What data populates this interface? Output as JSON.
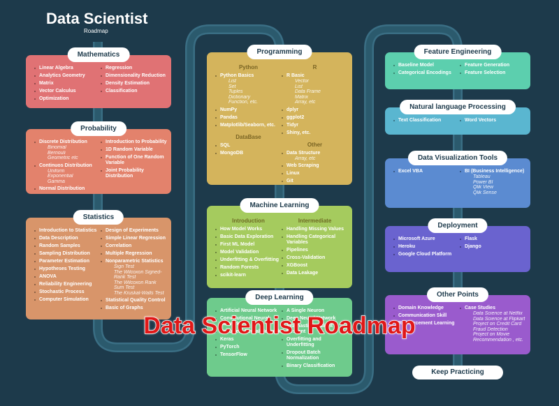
{
  "header": {
    "title": "Data Scientist",
    "subtitle": "Roadmap"
  },
  "panels": [
    {
      "title": "Mathematics",
      "color": "#e07274",
      "cols": [
        [
          {
            "items": [
              {
                "t": "Linear Algebra"
              },
              {
                "t": "Analytics Geometry"
              },
              {
                "t": "Matrix"
              },
              {
                "t": "Vector Calculus"
              },
              {
                "t": "Optimization"
              }
            ]
          }
        ],
        [
          {
            "items": [
              {
                "t": "Regression"
              },
              {
                "t": "Dimensionality Reduction"
              },
              {
                "t": "Density Estimation"
              },
              {
                "t": "Classification"
              }
            ]
          }
        ]
      ]
    },
    {
      "title": "Probability",
      "color": "#e3826c",
      "cols": [
        [
          {
            "items": [
              {
                "t": "Discrete Distribution",
                "sub": [
                  "Binomial",
                  "Bernouli",
                  "Geometric etc"
                ]
              },
              {
                "t": "Continuos Distribution",
                "sub": [
                  "Uniform",
                  "Exponential",
                  "Gamma"
                ]
              },
              {
                "t": "Normal Distribution"
              }
            ]
          }
        ],
        [
          {
            "items": [
              {
                "t": "Introduction to Probability"
              },
              {
                "t": "1D Random Variable"
              },
              {
                "t": "Function of One Random Variable"
              },
              {
                "t": "Joint Probability Distribution"
              }
            ]
          }
        ]
      ]
    },
    {
      "title": "Statistics",
      "color": "#d8956a",
      "cols": [
        [
          {
            "items": [
              {
                "t": "Introduction to Statistics"
              },
              {
                "t": "Data Description"
              },
              {
                "t": "Random Samples"
              },
              {
                "t": "Sampling Distribution"
              },
              {
                "t": "Parameter Estimation"
              },
              {
                "t": "Hypotheses Testing"
              },
              {
                "t": "ANOVA"
              },
              {
                "t": "Reliability Engineering"
              },
              {
                "t": "Stochastic Process"
              },
              {
                "t": "Computer Simulation"
              }
            ]
          }
        ],
        [
          {
            "items": [
              {
                "t": "Design of Experiments"
              },
              {
                "t": "Simple Linear Regression"
              },
              {
                "t": "Correlation"
              },
              {
                "t": "Multiple Regression"
              },
              {
                "t": "Nonparametric Statistics",
                "sub": [
                  "Sign Test",
                  "The Wilcoxon Signed-Rank Test",
                  "The Wilcoxon Rank Sum Test",
                  "The Kruskal-Walls Test"
                ]
              },
              {
                "t": "Statistical Quality Control"
              },
              {
                "t": "Basic of Graphs"
              }
            ]
          }
        ]
      ]
    },
    {
      "title": "Programming",
      "color": "#d4b45c",
      "cols": [
        [
          {
            "heading": "Python",
            "items": [
              {
                "t": "Python Basics",
                "sub": [
                  "List",
                  "Set",
                  "Tuples",
                  "Dictionary",
                  "Function, etc."
                ]
              },
              {
                "t": "NumPy"
              },
              {
                "t": "Pandas"
              },
              {
                "t": "Matplotlib/Seaborn, etc."
              }
            ]
          },
          {
            "heading": "DataBase",
            "items": [
              {
                "t": "SQL"
              },
              {
                "t": "MongoDB"
              }
            ]
          }
        ],
        [
          {
            "heading": "R",
            "items": [
              {
                "t": "R Basic",
                "sub": [
                  "Vector",
                  "List",
                  "Data Frame",
                  "Matrix",
                  "Array, etc"
                ]
              },
              {
                "t": "dplyr"
              },
              {
                "t": "ggplot2"
              },
              {
                "t": "Tidyr"
              },
              {
                "t": "Shiny, etc."
              }
            ]
          },
          {
            "heading": "Other",
            "items": [
              {
                "t": "Data Structure",
                "sub": [
                  "Array, etc"
                ]
              },
              {
                "t": "Web Scraping"
              },
              {
                "t": "Linux"
              },
              {
                "t": "Git"
              }
            ]
          }
        ]
      ]
    },
    {
      "title": "Machine Learning",
      "color": "#a5cb5e",
      "cols": [
        [
          {
            "heading": "Introduction",
            "items": [
              {
                "t": "How Model Works"
              },
              {
                "t": "Basic Data Exploration"
              },
              {
                "t": "First ML Model"
              },
              {
                "t": "Model Validation"
              },
              {
                "t": "Underfitting & Overfitting"
              },
              {
                "t": "Random Forests"
              },
              {
                "t": "scikit-learn"
              }
            ]
          }
        ],
        [
          {
            "heading": "Intermediate",
            "items": [
              {
                "t": "Handling Missing Values"
              },
              {
                "t": "Handling Categorical Variables"
              },
              {
                "t": "Pipelines"
              },
              {
                "t": "Cross-Validation"
              },
              {
                "t": "XGBoost"
              },
              {
                "t": "Data Leakage"
              }
            ]
          }
        ]
      ]
    },
    {
      "title": "Deep Learning",
      "color": "#6ecb8c",
      "cols": [
        [
          {
            "items": [
              {
                "t": "Artificial Neural Network"
              },
              {
                "t": "Convolutional Neural Network"
              },
              {
                "t": "Recurrent Neural Network"
              },
              {
                "t": "Keras"
              },
              {
                "t": "PyTorch"
              },
              {
                "t": "TensorFlow"
              }
            ]
          }
        ],
        [
          {
            "items": [
              {
                "t": "A Single Neuron"
              },
              {
                "t": "Deep Neural Network"
              },
              {
                "t": "Stochastic Gradient Descent"
              },
              {
                "t": "Overfitting and Underfitting"
              },
              {
                "t": "Dropout Batch Normalization"
              },
              {
                "t": "Binary Classification"
              }
            ]
          }
        ]
      ]
    },
    {
      "title": "Feature Engineering",
      "color": "#5ccfae",
      "cols": [
        [
          {
            "items": [
              {
                "t": "Baseline Model"
              },
              {
                "t": "Categorical Encodings"
              }
            ]
          }
        ],
        [
          {
            "items": [
              {
                "t": "Feature Generation"
              },
              {
                "t": "Feature Selection"
              }
            ]
          }
        ]
      ]
    },
    {
      "title": "Natural language Processing",
      "color": "#5ab6d0",
      "cols": [
        [
          {
            "items": [
              {
                "t": "Text Classification"
              }
            ]
          }
        ],
        [
          {
            "items": [
              {
                "t": "Word Vectors"
              }
            ]
          }
        ]
      ]
    },
    {
      "title": "Data Visualization Tools",
      "color": "#5b8bd1",
      "cols": [
        [
          {
            "items": [
              {
                "t": "Excel VBA"
              }
            ]
          }
        ],
        [
          {
            "items": [
              {
                "t": "BI (Business Intelligence)",
                "sub": [
                  "Tableau",
                  "Power BI",
                  "Qlik View",
                  "Qlik Sense"
                ]
              }
            ]
          }
        ]
      ]
    },
    {
      "title": "Deployment",
      "color": "#6a63cf",
      "cols": [
        [
          {
            "items": [
              {
                "t": "Microsoft Azure"
              },
              {
                "t": "Heroku"
              },
              {
                "t": "Google Cloud Platform"
              }
            ]
          }
        ],
        [
          {
            "items": [
              {
                "t": "Flask"
              },
              {
                "t": "Django"
              }
            ]
          }
        ]
      ]
    },
    {
      "title": "Other Points",
      "color": "#9a5bcd",
      "cols": [
        [
          {
            "items": [
              {
                "t": "Domain Knowledge"
              },
              {
                "t": "Communication Skill"
              },
              {
                "t": "Reinforcement Learning"
              }
            ]
          }
        ],
        [
          {
            "items": [
              {
                "t": "Case Studies",
                "sub": [
                  "Data Science at Netflix",
                  "Data Science at Flipkart",
                  "Project on Credit Card Fraud Detection",
                  "Project on Movie Recommendation , etc."
                ]
              }
            ]
          }
        ]
      ]
    }
  ],
  "footer": {
    "keep_practicing": "Keep Practicing"
  },
  "watermark": "Data Scientist Roadmap"
}
